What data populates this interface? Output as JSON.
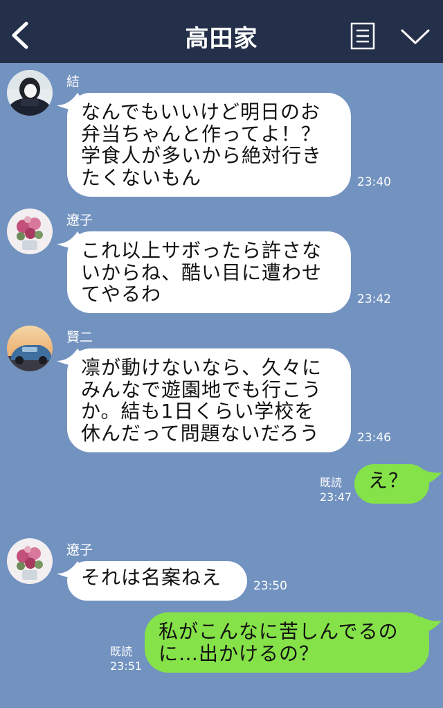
{
  "header": {
    "title": "高田家"
  },
  "messages": [
    {
      "sender": "結",
      "lines": [
        "なんでもいいけど明日のお",
        "弁当ちゃんと作ってよ！？",
        "学食人が多いから絶対行き",
        "たくないもん"
      ],
      "time": "23:40"
    },
    {
      "sender": "遼子",
      "lines": [
        "これ以上サボったら許さな",
        "いからね、酷い目に遭わせ",
        "てやるわ"
      ],
      "time": "23:42"
    },
    {
      "sender": "賢二",
      "lines": [
        "凛が動けないなら、久々に",
        "みんなで遊園地でも行こう",
        "か。結も1日くらい学校を",
        "休んだって問題ないだろう"
      ],
      "time": "23:46"
    },
    {
      "lines": [
        "え？"
      ],
      "read": "既読",
      "time": "23:47"
    },
    {
      "sender": "遼子",
      "lines": [
        "それは名案ねえ"
      ],
      "time": "23:50"
    },
    {
      "lines": [
        "私がこんなに苦しんでるの",
        "に…出かけるの？"
      ],
      "read": "既読",
      "time": "23:51"
    }
  ],
  "icons": [
    "back-arrow-icon",
    "notes-menu-icon",
    "chevron-down-icon"
  ],
  "colors": {
    "background": "#7292c0",
    "header": "#243049",
    "incoming_bubble": "#ffffff",
    "outgoing_bubble": "#85e249"
  }
}
